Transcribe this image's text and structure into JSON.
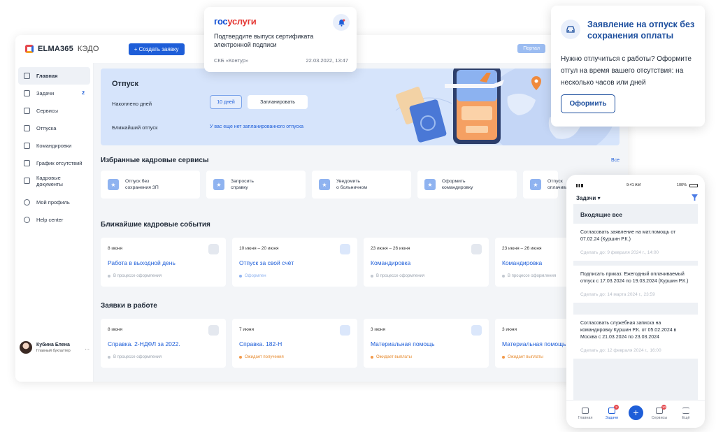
{
  "app": {
    "logo_brand": "ELMA365",
    "logo_product": "КЭДО",
    "create_button": "+ Создать заявку",
    "portal_button": "Портал"
  },
  "sidebar": {
    "items": [
      {
        "label": "Главная",
        "icon": "home-icon"
      },
      {
        "label": "Задачи",
        "icon": "tasks-icon",
        "badge": "2"
      },
      {
        "label": "Сервисы",
        "icon": "services-icon"
      },
      {
        "label": "Отпуска",
        "icon": "vacation-icon"
      },
      {
        "label": "Командировки",
        "icon": "plane-icon"
      },
      {
        "label": "График отсутствий",
        "icon": "calendar-icon"
      },
      {
        "label": "Кадровые документы",
        "icon": "document-icon"
      },
      {
        "label": "Мой профиль",
        "icon": "user-icon"
      },
      {
        "label": "Help center",
        "icon": "help-icon"
      }
    ],
    "profile": {
      "name": "Кубина Елена",
      "role": "Главный бухгалтер",
      "more": "..."
    }
  },
  "vacation": {
    "title": "Отпуск",
    "accrued_label": "Накоплено дней",
    "accrued_value": "10 дней",
    "plan_button": "Запланировать",
    "next_label": "Ближайший отпуск",
    "next_value": "У вас еще нет запланированного отпуска"
  },
  "services": {
    "title": "Избранные кадровые сервисы",
    "all_link": "Все",
    "items": [
      {
        "line1": "Отпуск без",
        "line2": "сохранения ЗП"
      },
      {
        "line1": "Запросить",
        "line2": "справку"
      },
      {
        "line1": "Уведомить",
        "line2": "о больничном"
      },
      {
        "line1": "Оформить",
        "line2": "командировку"
      },
      {
        "line1": "Отпуск",
        "line2": "оплачиваемый"
      }
    ]
  },
  "events": {
    "title": "Ближайшие кадровые события",
    "items": [
      {
        "date": "8 июня",
        "title": "Работа в выходной день",
        "status": "В процессе оформления",
        "status_type": "gray"
      },
      {
        "date": "10 июня – 20 июня",
        "title": "Отпуск за свой счёт",
        "status": "Оформлен",
        "status_type": "blue"
      },
      {
        "date": "23 июня – 26 июня",
        "title": "Командировка",
        "status": "В процессе оформления",
        "status_type": "gray"
      },
      {
        "date": "23 июня – 26 июня",
        "title": "Командировка",
        "status": "В процессе оформления",
        "status_type": "gray"
      }
    ]
  },
  "requests": {
    "title": "Заявки в работе",
    "items": [
      {
        "date": "8 июня",
        "title": "Справка. 2-НДФЛ за 2022.",
        "status": "В процессе оформления",
        "status_type": "gray"
      },
      {
        "date": "7 июня",
        "title": "Справка. 182-Н",
        "status": "Ожидает получения",
        "status_type": "orange"
      },
      {
        "date": "3 июня",
        "title": "Материальная помощь",
        "status": "Ожидает выплаты",
        "status_type": "orange"
      },
      {
        "date": "3 июня",
        "title": "Материальная помощь",
        "status": "Ожидает выплаты",
        "status_type": "orange"
      }
    ]
  },
  "gosuslugi": {
    "logo_part1": "гос",
    "logo_part2": "услуги",
    "message": "Подтвердите выпуск сертификата электронной подписи",
    "from": "СКБ «Контур»",
    "time": "22.03.2022, 13:47"
  },
  "leave_popup": {
    "title": "Заявление на отпуск без сохранения оплаты",
    "body": "Нужно отлучиться с работы? Оформите отгул на время вашего отсутствия: на несколько часов или дней",
    "button": "Оформить"
  },
  "mobile": {
    "time": "9:41 AM",
    "battery": "100%",
    "header": "Задачи ▾",
    "section": "Входящие все",
    "tasks": [
      {
        "text": "Согласовать заявление на мат.помощь от 07.02.24 (Куршин Р.К.)",
        "due": "Сделать до: 9 февраля 2024 г., 14:00"
      },
      {
        "text": "Подписать приказ: Ежегодный оплачиваемый отпуск с 17.03.2024 по 19.03.2024 (Куршин Р.К.)",
        "due": "Сделать до: 14 марта 2024 г., 23:59"
      },
      {
        "text": "Согласовать служебная записка на командировку Куршин Р.К. от 05.02.2024 в Москва с 21.03.2024 по 23.03.2024",
        "due": "Сделать до: 12 февраля 2024 г., 16:00"
      }
    ],
    "tabs": [
      {
        "label": "Главная",
        "badge": ""
      },
      {
        "label": "Задачи",
        "badge": "3"
      },
      {
        "label": "Сервисы",
        "badge": "10"
      },
      {
        "label": "Ещё",
        "badge": ""
      }
    ]
  },
  "colors": {
    "accent": "#1e5ed8",
    "hero_bg": "#d6e4fb",
    "popup_title": "#1d4f9e",
    "warning": "#f2994a"
  }
}
